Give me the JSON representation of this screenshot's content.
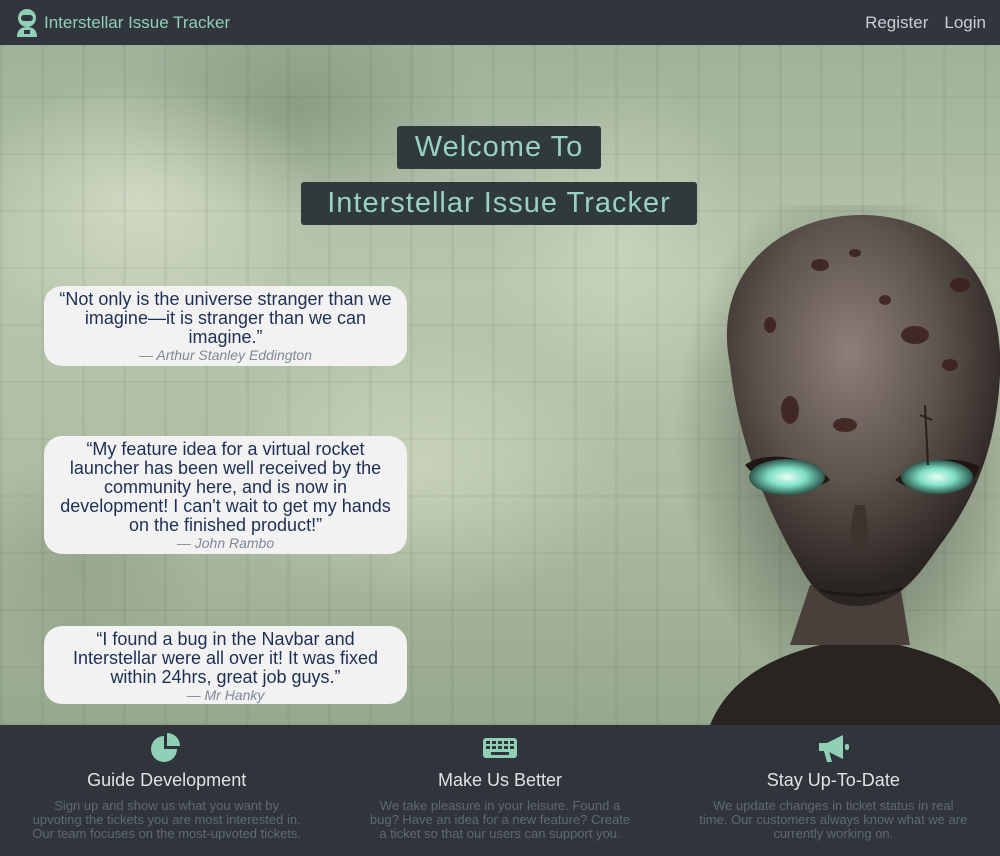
{
  "navbar": {
    "brand": "Interstellar Issue Tracker",
    "register": "Register",
    "login": "Login"
  },
  "hero": {
    "title_line1": "Welcome To",
    "title_line2": "Interstellar Issue Tracker",
    "quotes": [
      {
        "text": "“Not only is the universe stranger than we imagine—it is stranger than we can imagine.”",
        "author": "— Arthur Stanley Eddington"
      },
      {
        "text": "“My feature idea for a virtual rocket launcher has been well received by the community here, and is now in development! I can't wait to get my hands on the finished product!”",
        "author": "— John Rambo"
      },
      {
        "text": "“I found a bug in the Navbar and Interstellar were all over it! It was fixed within 24hrs, great job guys.”",
        "author": "— Mr Hanky"
      }
    ]
  },
  "features": [
    {
      "icon": "pie-chart-icon",
      "title": "Guide Development",
      "desc": "Sign up and show us what you want by upvoting the tickets you are most interested in. Our team focuses on the most-upvoted tickets."
    },
    {
      "icon": "keyboard-icon",
      "title": "Make Us Better",
      "desc": "We take pleasure in your leisure. Found a bug? Have an idea for a new feature? Create a ticket so that our users can support you."
    },
    {
      "icon": "megaphone-icon",
      "title": "Stay Up-To-Date",
      "desc": "We update changes in ticket status in real time. Our customers always know what we are currently working on."
    }
  ],
  "colors": {
    "navbar_bg": "#31363d",
    "brand": "#8fd0b6",
    "accent": "#8fd0b6",
    "title_box_bg": "#30393c",
    "quote_text": "#1e2f55"
  }
}
